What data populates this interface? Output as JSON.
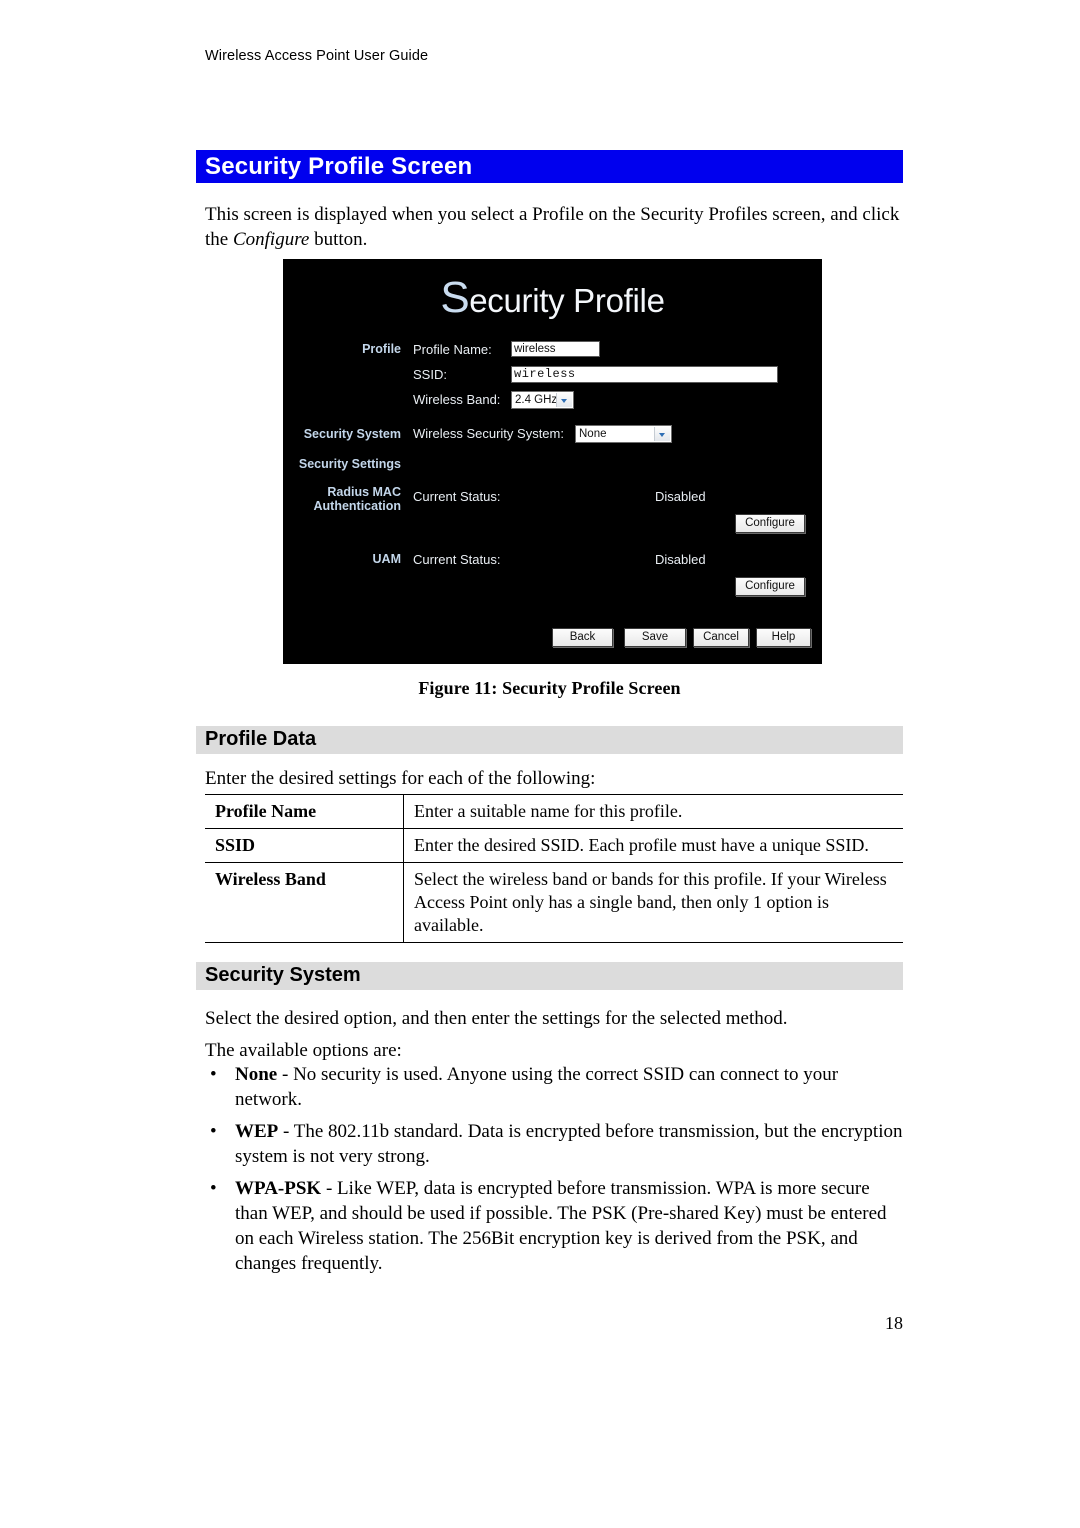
{
  "page": {
    "running_header": "Wireless Access Point User Guide",
    "number": "18",
    "title": "Security Profile Screen",
    "title_bar_color": "#0000ee",
    "section_head_color": "#dcdcdc"
  },
  "intro": {
    "line1_a": "This screen is displayed when you select a Profile on the Security Profiles screen, and click the ",
    "line1_b": "Configure",
    "line1_c": " button."
  },
  "figure": {
    "caption": "Figure 11: Security Profile Screen",
    "screen_title_cap": "S",
    "screen_title_rest": "ecurity Profile",
    "sections": {
      "profile": "Profile",
      "security_system": "Security System",
      "security_settings": "Security Settings",
      "radius_mac_line1": "Radius MAC",
      "radius_mac_line2": "Authentication",
      "uam": "UAM"
    },
    "fields": {
      "profile_name_label": "Profile Name:",
      "profile_name_value": "wireless",
      "ssid_label": "SSID:",
      "ssid_value": "wireless",
      "wireless_band_label": "Wireless Band:",
      "wireless_band_value": "2.4 GHz",
      "security_system_label": "Wireless Security System:",
      "security_system_value": "None",
      "radius_status_label": "Current Status:",
      "radius_status_value": "Disabled",
      "uam_status_label": "Current Status:",
      "uam_status_value": "Disabled"
    },
    "buttons": {
      "configure_radius": "Configure",
      "configure_uam": "Configure",
      "back": "Back",
      "save": "Save",
      "cancel": "Cancel",
      "help": "Help"
    }
  },
  "profile_data": {
    "heading": "Profile Data",
    "intro": "Enter the desired settings for each of the following:",
    "rows": [
      {
        "term": "Profile Name",
        "desc": "Enter a suitable name for this profile."
      },
      {
        "term": "SSID",
        "desc": "Enter the desired SSID. Each profile must have a unique SSID."
      },
      {
        "term": "Wireless Band",
        "desc": "Select the wireless band or bands for this profile. If your Wireless Access Point only has a single band, then only 1 option is available."
      }
    ]
  },
  "security_system": {
    "heading": "Security System",
    "para1": "Select the desired option, and then enter the settings for the selected method.",
    "para2": "The available options are:",
    "options": [
      {
        "name": "None",
        "sep": " - ",
        "desc": "No security is used. Anyone using the correct SSID can connect to your network."
      },
      {
        "name": "WEP",
        "sep": " - ",
        "desc": "The 802.11b standard. Data is encrypted before transmission, but the encryption system is not very strong."
      },
      {
        "name": "WPA-PSK",
        "sep": " - ",
        "desc": "Like WEP, data is encrypted before transmission. WPA is more secure than WEP, and should be used if possible. The PSK (Pre-shared Key) must be entered on each Wireless station. The 256Bit encryption key is derived from the PSK, and changes frequently."
      }
    ]
  }
}
